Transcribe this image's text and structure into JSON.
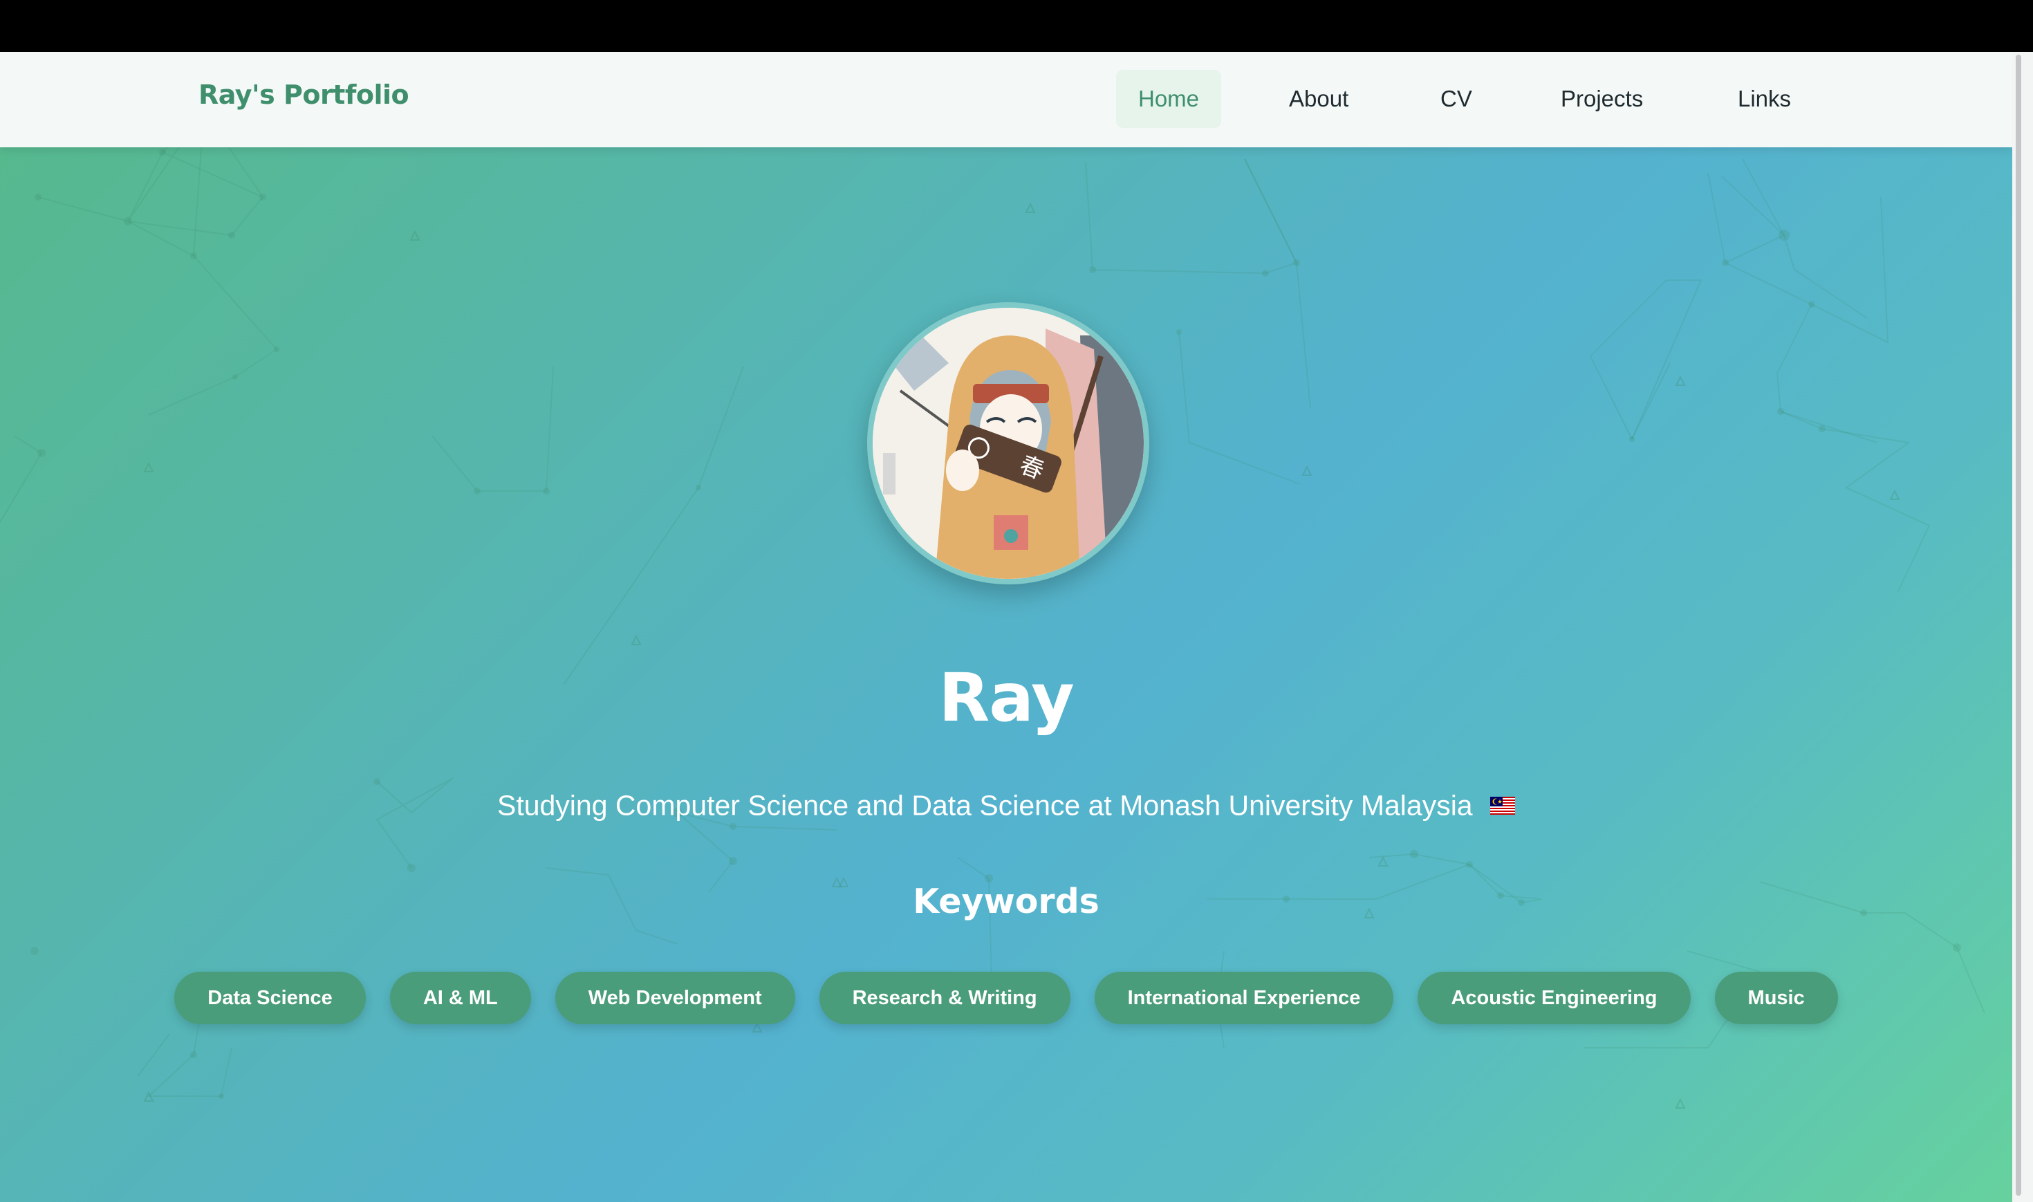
{
  "brand": {
    "title": "Ray's Portfolio",
    "color": "#3f8f6d"
  },
  "nav": {
    "items": [
      {
        "label": "Home",
        "active": true
      },
      {
        "label": "About",
        "active": false
      },
      {
        "label": "CV",
        "active": false
      },
      {
        "label": "Projects",
        "active": false
      },
      {
        "label": "Links",
        "active": false
      }
    ]
  },
  "hero": {
    "avatar_icon": "anime-portrait-avatar",
    "name": "Ray",
    "tagline": "Studying Computer Science and Data Science at Monash University Malaysia",
    "flag_icon": "malaysia-flag-icon"
  },
  "keywords": {
    "title": "Keywords",
    "items": [
      "Data Science",
      "AI & ML",
      "Web Development",
      "Research & Writing",
      "International Experience",
      "Acoustic Engineering",
      "Music"
    ]
  },
  "colors": {
    "accent": "#3f8f6d",
    "chip": "#4a9d7a",
    "gradient_start": "#56b98a",
    "gradient_mid": "#54b2cf",
    "gradient_end": "#66d19e"
  }
}
